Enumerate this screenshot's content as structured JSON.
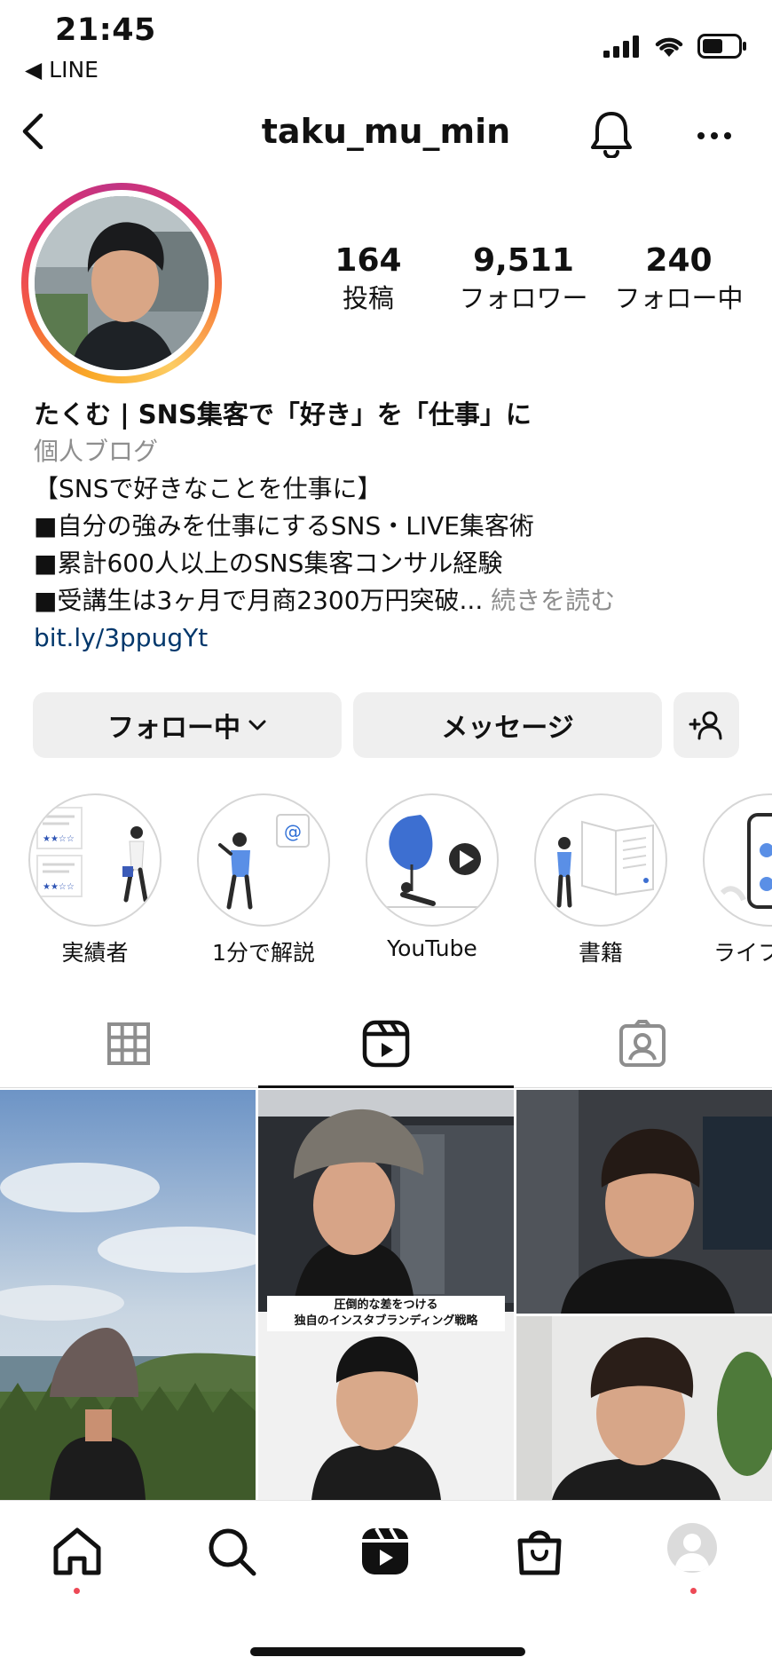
{
  "status_bar": {
    "time": "21:45",
    "back_app": "◀ LINE"
  },
  "header": {
    "username": "taku_mu_min"
  },
  "stats": [
    {
      "value": "164",
      "label": "投稿"
    },
    {
      "value": "9,511",
      "label": "フォロワー"
    },
    {
      "value": "240",
      "label": "フォロー中"
    }
  ],
  "bio": {
    "name": "たくむ | SNS集客で「好き」を「仕事」に",
    "category": "個人ブログ",
    "lines": [
      "【SNSで好きなことを仕事に】",
      "■自分の強みを仕事にするSNS・LIVE集客術",
      "■累計600人以上のSNS集客コンサル経験",
      "■受講生は3ヶ月で月商2300万円突破..."
    ],
    "more": "続きを読む",
    "link": "bit.ly/3ppugYt"
  },
  "buttons": {
    "following": "フォロー中",
    "message": "メッセージ"
  },
  "highlights": [
    {
      "label": "実績者"
    },
    {
      "label": "1分で解説"
    },
    {
      "label": "YouTube"
    },
    {
      "label": "書籍"
    },
    {
      "label": "ライフ"
    }
  ],
  "grid": {
    "caption": [
      "圧倒的な差をつける",
      "独自のインスタブランディング戦略"
    ]
  },
  "colors": {
    "link": "#00376b",
    "muted": "#8e8e8e",
    "button_bg": "#efefef",
    "notification_dot": "#ed4956"
  }
}
